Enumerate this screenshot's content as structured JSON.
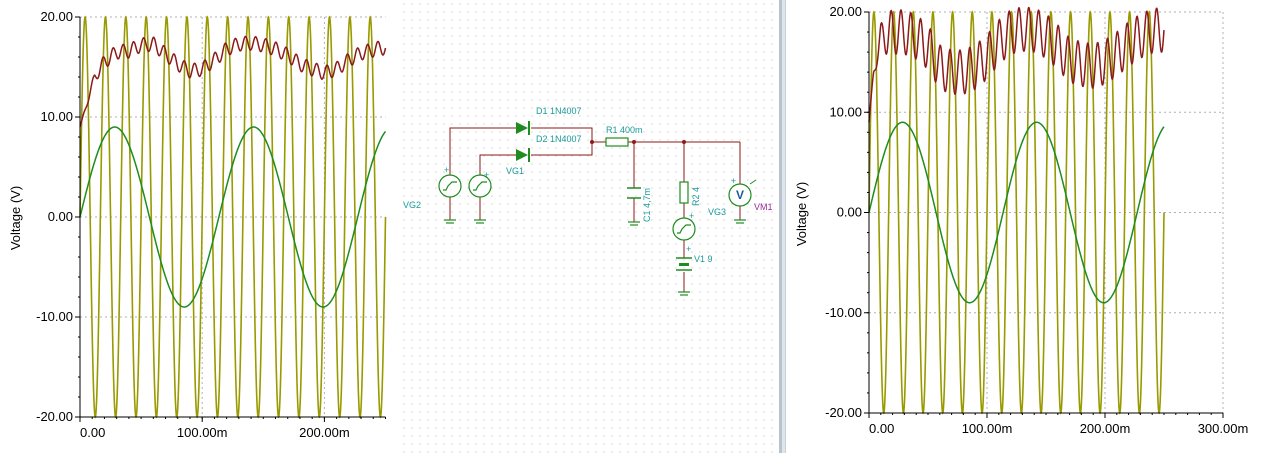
{
  "colors": {
    "carrier": "#999900",
    "sine": "#1e8c1e",
    "output": "#8b1a1a",
    "grid": "#b0b0b0",
    "wire": "#8b1a1a",
    "component": "#1a9a9a",
    "meter": "#9a2a9a"
  },
  "left_chart": {
    "chart_data": {
      "type": "line",
      "ylabel": "Voltage (V)",
      "xlabel": "",
      "xlim": [
        0,
        0.25
      ],
      "ylim": [
        -20,
        20
      ],
      "x_ticks": [
        "0.00",
        "100.00m",
        "200.00m"
      ],
      "y_ticks": [
        "20.00",
        "10.00",
        "0.00",
        "-10.00",
        "-20.00"
      ],
      "grid": true,
      "series": [
        {
          "color": "carrier",
          "kind": "carrier",
          "amplitude": 20,
          "frequency": 60,
          "x_end": 0.25
        },
        {
          "color": "sine",
          "kind": "sine",
          "amplitude": 9,
          "frequency": 8.8,
          "x_end": 0.25
        },
        {
          "color": "output",
          "kind": "output",
          "x_end": 0.25,
          "points": [
            [
              0,
              9
            ],
            [
              0.006,
              11.5
            ],
            [
              0.012,
              14
            ],
            [
              0.02,
              15.5
            ],
            [
              0.03,
              16.5
            ],
            [
              0.04,
              16.6
            ],
            [
              0.05,
              17.2
            ],
            [
              0.06,
              17.3
            ],
            [
              0.07,
              16.3
            ],
            [
              0.08,
              15.3
            ],
            [
              0.09,
              14.6
            ],
            [
              0.1,
              14.8
            ],
            [
              0.11,
              15.7
            ],
            [
              0.12,
              16.8
            ],
            [
              0.13,
              17.3
            ],
            [
              0.14,
              17.4
            ],
            [
              0.15,
              17.2
            ],
            [
              0.16,
              16.8
            ],
            [
              0.17,
              16.2
            ],
            [
              0.18,
              15.3
            ],
            [
              0.19,
              14.8
            ],
            [
              0.2,
              14.4
            ],
            [
              0.21,
              14.8
            ],
            [
              0.22,
              15.7
            ],
            [
              0.23,
              16.4
            ],
            [
              0.24,
              16.7
            ],
            [
              0.245,
              16.9
            ]
          ],
          "ripple": 0.7
        }
      ]
    }
  },
  "right_chart": {
    "chart_data": {
      "type": "line",
      "ylabel": "Voltage (V)",
      "xlabel": "",
      "xlim": [
        0,
        0.3
      ],
      "ylim": [
        -20,
        20
      ],
      "x_ticks": [
        "0.00",
        "100.00m",
        "200.00m",
        "300.00m"
      ],
      "y_ticks": [
        "20.00",
        "10.00",
        "0.00",
        "-10.00",
        "-20.00"
      ],
      "grid": true,
      "series": [
        {
          "color": "carrier",
          "kind": "carrier",
          "amplitude": 20,
          "frequency": 60,
          "x_end": 0.25
        },
        {
          "color": "sine",
          "kind": "sine",
          "amplitude": 9,
          "frequency": 8.8,
          "x_end": 0.25
        },
        {
          "color": "output",
          "kind": "output",
          "x_end": 0.25,
          "points": [
            [
              0,
              9
            ],
            [
              0.004,
              14
            ],
            [
              0.01,
              17.5
            ],
            [
              0.02,
              18
            ],
            [
              0.03,
              18
            ],
            [
              0.04,
              17.5
            ],
            [
              0.05,
              16.5
            ],
            [
              0.06,
              14.5
            ],
            [
              0.07,
              14
            ],
            [
              0.08,
              14
            ],
            [
              0.09,
              14.5
            ],
            [
              0.1,
              15.5
            ],
            [
              0.11,
              17
            ],
            [
              0.12,
              18
            ],
            [
              0.13,
              18.3
            ],
            [
              0.14,
              18.2
            ],
            [
              0.15,
              17.6
            ],
            [
              0.16,
              16.5
            ],
            [
              0.17,
              15.2
            ],
            [
              0.18,
              14.8
            ],
            [
              0.19,
              14.6
            ],
            [
              0.2,
              15
            ],
            [
              0.21,
              15.8
            ],
            [
              0.22,
              16.8
            ],
            [
              0.23,
              17.6
            ],
            [
              0.24,
              18.1
            ],
            [
              0.245,
              18.2
            ]
          ],
          "ripple": 2.2
        }
      ]
    }
  },
  "schematic": {
    "labels": {
      "d1": "D1 1N4007",
      "d2": "D2 1N4007",
      "r1": "R1 400m",
      "vg2": "VG2",
      "vg1": "VG1",
      "c1": "C1 4,7m",
      "r2": "R2 4",
      "vg3": "VG3",
      "vm1": "VM1",
      "v1": "V1 9",
      "vm_symbol": "V",
      "plus": "+"
    }
  }
}
